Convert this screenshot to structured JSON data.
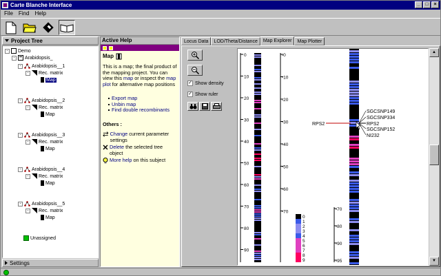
{
  "window": {
    "title": "Carte Blanche Interface",
    "min": "_",
    "max": "□",
    "close": "×"
  },
  "menu": [
    "File",
    "Find",
    "Help"
  ],
  "toolbar": {
    "icons": [
      "new-document-icon",
      "open-folder-icon",
      "save-disk-icon",
      "book-icon"
    ]
  },
  "project_tree": {
    "title": "Project Tree",
    "root": "Demo",
    "project": "Arabidopsis_",
    "items": [
      {
        "label": "Arabidopsis__1",
        "matrix": "Rec. matrix",
        "map": "Map",
        "selected": true
      },
      {
        "label": "Arabidopsis__2",
        "matrix": "Rec. matrix",
        "map": "Map"
      },
      {
        "label": "Arabidopsis__3",
        "matrix": "Rec. matrix",
        "map": "Map"
      },
      {
        "label": "Arabidopsis__4",
        "matrix": "Rec. matrix",
        "map": "Map"
      },
      {
        "label": "Arabidopsis__5",
        "matrix": "Rec. matrix",
        "map": "Map"
      }
    ],
    "unassigned": "Unassigned",
    "expand": "+",
    "collapse": "-"
  },
  "settings": {
    "label": "Settings"
  },
  "help": {
    "title": "Active Help",
    "heading": "Map",
    "intro1": "This is a map; the final product of the mapping project. You can view this ",
    "intro_link1": "map",
    "intro2": " or inspect the ",
    "intro_link2": "map plot",
    "intro3": " for alternative map positions",
    "actions": [
      "Export map",
      "Unbin map",
      "Find double recombinants"
    ],
    "others_title": "Others :",
    "change_link": "Change",
    "change_text": " current parameter settings",
    "delete_link": "Delete",
    "delete_text": " the selected tree object",
    "more_link": "More help",
    "more_text": " on this subject"
  },
  "tabs": [
    {
      "label": "Locus Data"
    },
    {
      "label": "LOD/Theta/Distance"
    },
    {
      "label": "Map Explorer",
      "active": true
    },
    {
      "label": "Map Plotter"
    }
  ],
  "controls": {
    "zoom_in": "zoom-in-icon",
    "zoom_out": "zoom-out-icon",
    "show_density": "Show density",
    "show_density_checked": true,
    "show_ruler": "Show ruler",
    "show_ruler_checked": true,
    "check_mark": "✓"
  },
  "map": {
    "ruler_small": [
      "0",
      "10",
      "20",
      "30",
      "40",
      "50",
      "60",
      "70",
      "80",
      "90",
      "95"
    ],
    "ruler_large_top": [
      "0",
      "10",
      "20",
      "30",
      "40",
      "50",
      "60",
      "70"
    ],
    "ruler_large_bottom": [
      "70",
      "80",
      "90",
      "95"
    ],
    "markers": [
      "SGCSNP149",
      "SGCSNP334",
      "RPS2",
      "SGCSNP152",
      "NI232"
    ],
    "highlight": "RPS2",
    "legend": [
      "0",
      "1",
      "2",
      "3",
      "4",
      "5",
      "6",
      "7",
      "8",
      "9"
    ],
    "colors": {
      "black": "#000000",
      "blue": "#3a5ae8",
      "light": "#8c8cf0",
      "pink": "#e040c0",
      "red": "#ff0060",
      "accent": "#000080"
    }
  }
}
